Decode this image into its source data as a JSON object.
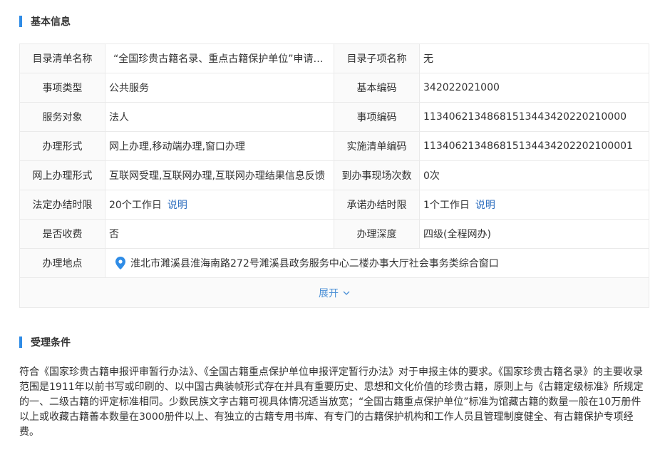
{
  "basic_section": {
    "title": "基本信息"
  },
  "table": {
    "rows": [
      {
        "l1": "目录清单名称",
        "v1": "“全国珍贵古籍名录、重点古籍保护单位”申请审批",
        "l2": "目录子项名称",
        "v2": "无"
      },
      {
        "l1": "事项类型",
        "v1": "公共服务",
        "l2": "基本编码",
        "v2": "342022021000"
      },
      {
        "l1": "服务对象",
        "v1": "法人",
        "l2": "事项编码",
        "v2": "11340621348681513443420220210000"
      },
      {
        "l1": "办理形式",
        "v1": "网上办理,移动端办理,窗口办理",
        "l2": "实施清单编码",
        "v2": "113406213486815134434202202100001"
      },
      {
        "l1": "网上办理形式",
        "v1": "互联网受理,互联网办理,互联网办理结果信息反馈",
        "l2": "到办事现场次数",
        "v2": "0次"
      },
      {
        "l1": "法定办结时限",
        "v1": "20个工作日",
        "link1": "说明",
        "l2": "承诺办结时限",
        "v2": "1个工作日",
        "link2": "说明"
      },
      {
        "l1": "是否收费",
        "v1": "否",
        "l2": "办理深度",
        "v2": "四级(全程网办)"
      }
    ],
    "address": {
      "label": "办理地点",
      "value": "淮北市濉溪县淮海南路272号濉溪县政务服务中心二楼办事大厅社会事务类综合窗口",
      "icon": "location-pin-icon"
    },
    "expand_label": "展开"
  },
  "condition_section": {
    "title": "受理条件",
    "text": "符合《国家珍贵古籍申报评审暂行办法》、《全国古籍重点保护单位申报评定暂行办法》对于申报主体的要求。《国家珍贵古籍名录》的主要收录范围是1911年以前书写或印刷的、以中国古典装帧形式存在并具有重要历史、思想和文化价值的珍贵古籍，原则上与《古籍定级标准》所规定的一、二级古籍的评定标准相同。少数民族文字古籍可视具体情况适当放宽；“全国古籍重点保护单位”标准为馆藏古籍的数量一般在10万册件以上或收藏古籍善本数量在3000册件以上、有独立的古籍专用书库、有专门的古籍保护机构和工作人员且管理制度健全、有古籍保护专项经费。"
  },
  "colors": {
    "accent": "#2f8ce6",
    "link": "#2f6fbf",
    "pin": "#2f8ce6"
  }
}
